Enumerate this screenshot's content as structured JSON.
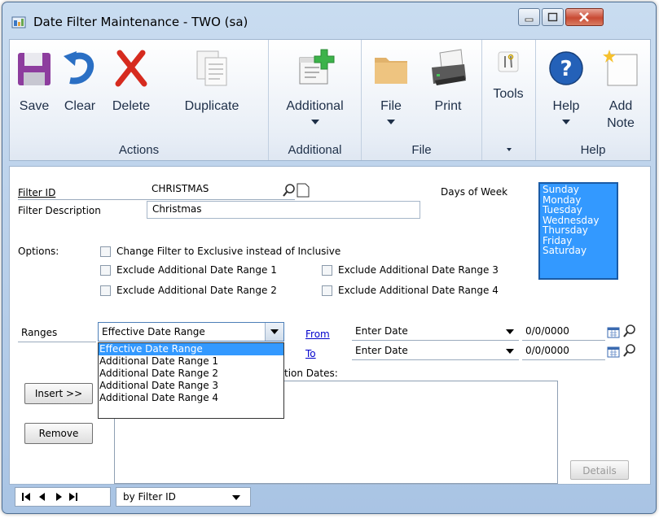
{
  "window": {
    "title": "Date Filter Maintenance  -  TWO (sa)"
  },
  "ribbon": {
    "groups": {
      "actions": "Actions",
      "additional": "Additional",
      "file": "File",
      "tools": "",
      "help": "Help"
    },
    "buttons": {
      "save": "Save",
      "clear": "Clear",
      "delete": "Delete",
      "duplicate": "Duplicate",
      "additional": "Additional",
      "file": "File",
      "print": "Print",
      "tools": "Tools",
      "help": "Help",
      "add_note_1": "Add",
      "add_note_2": "Note"
    }
  },
  "form": {
    "filter_id_label": "Filter ID",
    "filter_id_value": "CHRISTMAS",
    "filter_desc_label": "Filter Description",
    "filter_desc_value": "Christmas",
    "days_label": "Days of Week",
    "days": [
      "Sunday",
      "Monday",
      "Tuesday",
      "Wednesday",
      "Thursday",
      "Friday",
      "Saturday"
    ],
    "options_label": "Options:",
    "opt_exclusive": "Change Filter to Exclusive instead of Inclusive",
    "opt_ex1": "Exclude Additional Date Range 1",
    "opt_ex2": "Exclude Additional Date Range 2",
    "opt_ex3": "Exclude Additional Date Range 3",
    "opt_ex4": "Exclude Additional Date Range 4",
    "ranges_label": "Ranges",
    "ranges_value": "Effective Date Range",
    "ranges_options": [
      "Effective Date Range",
      "Additional Date Range 1",
      "Additional Date Range 2",
      "Additional Date Range 3",
      "Additional Date Range 4"
    ],
    "from_label": "From",
    "to_label": "To",
    "from_type": "Enter Date",
    "to_type": "Enter Date",
    "from_date": "0/0/0000",
    "to_date": "0/0/0000",
    "exception_label_partial": "tion Dates:",
    "insert_btn": "Insert >>",
    "remove_btn": "Remove",
    "details_btn": "Details"
  },
  "footer": {
    "sort_value": "by Filter ID"
  },
  "colors": {
    "accent": "#3399ff",
    "link": "#0000cc"
  }
}
